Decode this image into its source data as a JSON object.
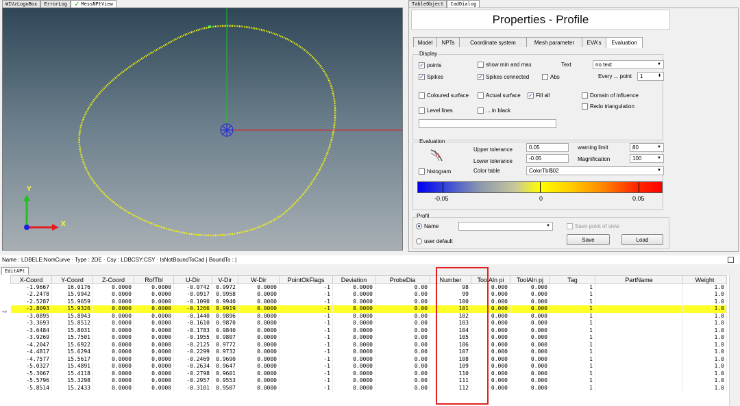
{
  "top_tabs_left": [
    {
      "label": "WIVzLogoBox",
      "active": false
    },
    {
      "label": "ErrorLog",
      "active": false
    },
    {
      "label": "MessNPtView",
      "active": true
    }
  ],
  "top_tabs_right": [
    {
      "label": "TableObject",
      "active": false
    },
    {
      "label": "CadDialog",
      "active": true
    }
  ],
  "viewport": {
    "axis_x_label": "X",
    "axis_y_label": "Y",
    "curve_color": "#ffff00",
    "axis_x_color": "#e02020",
    "axis_y_color": "#20c020",
    "axis_z_color": "#2020e0"
  },
  "properties": {
    "title": "Properties - Profile",
    "tabs": [
      "Model",
      "NPTs",
      "Coordinate system",
      "Mesh parameter",
      "EVA's",
      "Evaluation"
    ],
    "active_tab": "Evaluation",
    "display": {
      "group_label": "Display",
      "points_label": "points",
      "points_checked": true,
      "show_minmax_label": "show min and max",
      "show_minmax_checked": false,
      "text_label": "Text",
      "text_value": "no text",
      "spikes_label": "Spikes",
      "spikes_checked": true,
      "spikes_connected_label": "Spikes connected",
      "spikes_connected_checked": true,
      "abs_label": "Abs",
      "abs_checked": false,
      "every_point_label": "Every ... point",
      "every_point_value": "1",
      "coloured_surface_label": "Coloured surface",
      "actual_surface_label": "Actual surface",
      "fill_all_label": "Fill all",
      "fill_all_checked": true,
      "domain_label": "Domain of influence",
      "redo_label": "Redo triangulation",
      "level_lines_label": "Level lines",
      "in_black_label": "... in black"
    },
    "evaluation": {
      "group_label": "Evaluation",
      "upper_tol_label": "Upper tolerance",
      "upper_tol_value": "0.05",
      "lower_tol_label": "Lower tolerance",
      "lower_tol_value": "-0.05",
      "warning_label": "warning limit",
      "warning_value": "80",
      "magnification_label": "Magnification",
      "magnification_value": "100",
      "histogram_label": "histogram",
      "color_table_label": "Color table",
      "color_table_value": "ColorTbl$02",
      "scale_min": "-0.05",
      "scale_mid": "0",
      "scale_max": "0.05"
    },
    "profil": {
      "group_label": "Profil",
      "name_label": "Name",
      "user_default_label": "user default",
      "save_point_label": "Save point of view",
      "save_button": "Save",
      "load_button": "Load"
    }
  },
  "name_bar": "Name : LDBELE:NomCurve · Type : 2DE · Csy : LDBCSY:CSY · IsNotBoundToCad  | BoundTo :  |",
  "table_tab": "EditAPt",
  "table": {
    "columns": [
      "X-Coord",
      "Y-Coord",
      "Z-Coord",
      "RofTbl",
      "U-Dir",
      "V-Dir",
      "W-Dir",
      "PointOkFlags",
      "Deviation",
      "ProbeDia",
      "Number",
      "ToolAln pi",
      "ToolAln pj",
      "Tag",
      "PartName",
      "Weight"
    ],
    "highlight_row": 3,
    "rows": [
      [
        "-1.9667",
        "16.0176",
        "0.0000",
        "0.0000",
        "-0.0742",
        "0.9972",
        "0.0000",
        "-1",
        "0.0000",
        "0.00",
        "98",
        "0.000",
        "0.000",
        "1",
        "",
        "1.0"
      ],
      [
        "-2.2478",
        "15.9942",
        "0.0000",
        "0.0000",
        "-0.0917",
        "0.9958",
        "0.0000",
        "-1",
        "0.0000",
        "0.00",
        "99",
        "0.000",
        "0.000",
        "1",
        "",
        "1.0"
      ],
      [
        "-2.5287",
        "15.9659",
        "0.0000",
        "0.0000",
        "-0.1090",
        "0.9940",
        "0.0000",
        "-1",
        "0.0000",
        "0.00",
        "100",
        "0.000",
        "0.000",
        "1",
        "",
        "1.0"
      ],
      [
        "-2.8093",
        "15.9326",
        "0.0000",
        "0.0000",
        "-0.1266",
        "0.9919",
        "0.0000",
        "-1",
        "0.0000",
        "0.00",
        "101",
        "0.000",
        "0.000",
        "1",
        "",
        "1.0"
      ],
      [
        "-3.0895",
        "15.8943",
        "0.0000",
        "0.0000",
        "-0.1440",
        "0.9896",
        "0.0000",
        "-1",
        "0.0000",
        "0.00",
        "102",
        "0.000",
        "0.000",
        "1",
        "",
        "1.0"
      ],
      [
        "-3.3693",
        "15.8512",
        "0.0000",
        "0.0000",
        "-0.1610",
        "0.9870",
        "0.0000",
        "-1",
        "0.0000",
        "0.00",
        "103",
        "0.000",
        "0.000",
        "1",
        "",
        "1.0"
      ],
      [
        "-3.6484",
        "15.8031",
        "0.0000",
        "0.0000",
        "-0.1783",
        "0.9840",
        "0.0000",
        "-1",
        "0.0000",
        "0.00",
        "104",
        "0.000",
        "0.000",
        "1",
        "",
        "1.0"
      ],
      [
        "-3.9269",
        "15.7501",
        "0.0000",
        "0.0000",
        "-0.1955",
        "0.9807",
        "0.0000",
        "-1",
        "0.0000",
        "0.00",
        "105",
        "0.000",
        "0.000",
        "1",
        "",
        "1.0"
      ],
      [
        "-4.2047",
        "15.6922",
        "0.0000",
        "0.0000",
        "-0.2125",
        "0.9772",
        "0.0000",
        "-1",
        "0.0000",
        "0.00",
        "106",
        "0.000",
        "0.000",
        "1",
        "",
        "1.0"
      ],
      [
        "-4.4817",
        "15.6294",
        "0.0000",
        "0.0000",
        "-0.2299",
        "0.9732",
        "0.0000",
        "-1",
        "0.0000",
        "0.00",
        "107",
        "0.000",
        "0.000",
        "1",
        "",
        "1.0"
      ],
      [
        "-4.7577",
        "15.5617",
        "0.0000",
        "0.0000",
        "-0.2469",
        "0.9690",
        "0.0000",
        "-1",
        "0.0000",
        "0.00",
        "108",
        "0.000",
        "0.000",
        "1",
        "",
        "1.0"
      ],
      [
        "-5.0327",
        "15.4891",
        "0.0000",
        "0.0000",
        "-0.2634",
        "0.9647",
        "0.0000",
        "-1",
        "0.0000",
        "0.00",
        "109",
        "0.000",
        "0.000",
        "1",
        "",
        "1.0"
      ],
      [
        "-5.3067",
        "15.4118",
        "0.0000",
        "0.0000",
        "-0.2798",
        "0.9601",
        "0.0000",
        "-1",
        "0.0000",
        "0.00",
        "110",
        "0.000",
        "0.000",
        "1",
        "",
        "1.0"
      ],
      [
        "-5.5796",
        "15.3298",
        "0.0000",
        "0.0000",
        "-0.2957",
        "0.9553",
        "0.0000",
        "-1",
        "0.0000",
        "0.00",
        "111",
        "0.000",
        "0.000",
        "1",
        "",
        "1.0"
      ],
      [
        "-5.8514",
        "15.2433",
        "0.0000",
        "0.0000",
        "-0.3101",
        "0.9507",
        "0.0000",
        "-1",
        "0.0000",
        "0.00",
        "112",
        "0.000",
        "0.000",
        "1",
        "",
        "1.0"
      ]
    ]
  }
}
